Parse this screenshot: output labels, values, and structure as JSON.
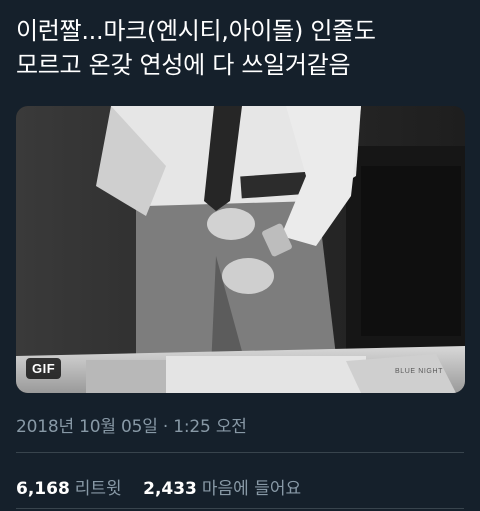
{
  "tweet": {
    "text_line1": "이런짤...마크(엔시티,아이돌) 인줄도",
    "text_line2": "모르고 온갖 연성에 다 쓰일거같음"
  },
  "media": {
    "type_badge": "GIF",
    "watermark": "BLUE NIGHT"
  },
  "meta": {
    "timestamp": "2018년 10월 05일 · 1:25 오전"
  },
  "stats": {
    "retweets_count": "6,168",
    "retweets_label": "리트윗",
    "likes_count": "2,433",
    "likes_label": "마음에 들어요"
  }
}
